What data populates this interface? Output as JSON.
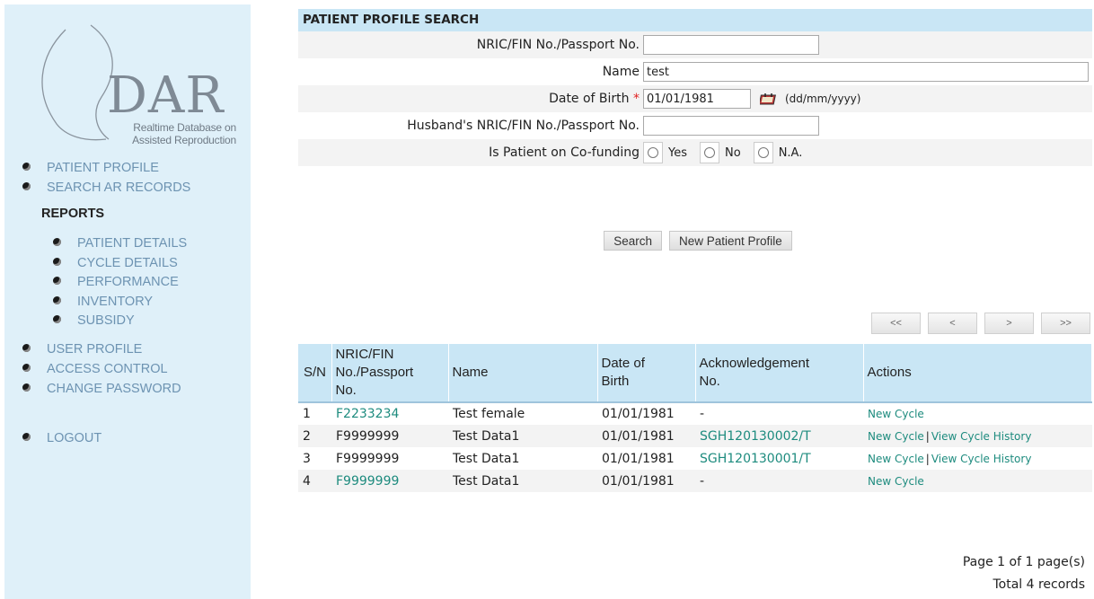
{
  "logo": {
    "wordmark": "DAR",
    "tagline_line1": "Realtime Database on",
    "tagline_line2": "Assisted Reproduction"
  },
  "sidebar": {
    "items_top": [
      "PATIENT PROFILE",
      "SEARCH AR RECORDS"
    ],
    "reports_header": "REPORTS",
    "reports_items": [
      "PATIENT DETAILS",
      "CYCLE DETAILS",
      "PERFORMANCE",
      "INVENTORY",
      "SUBSIDY"
    ],
    "items_bottom": [
      "USER PROFILE",
      "ACCESS CONTROL",
      "CHANGE PASSWORD"
    ],
    "logout": "LOGOUT"
  },
  "search_panel": {
    "title": "PATIENT PROFILE SEARCH",
    "nric_label": "NRIC/FIN No./Passport No.",
    "nric_value": "",
    "name_label": "Name",
    "name_value": "test",
    "dob_label": "Date of Birth",
    "dob_required_marker": "*",
    "dob_value": "01/01/1981",
    "dob_hint": "(dd/mm/yyyy)",
    "husband_label": "Husband's NRIC/FIN No./Passport No.",
    "husband_value": "",
    "cofunding_label": "Is Patient on Co-funding",
    "cofunding_options": [
      "Yes",
      "No",
      "N.A."
    ],
    "search_button": "Search",
    "new_profile_button": "New Patient Profile"
  },
  "pager": {
    "first": "<<",
    "prev": "<",
    "next": ">",
    "last": ">>"
  },
  "results": {
    "headers": {
      "sn": "S/N",
      "nric_l1": "NRIC/FIN",
      "nric_l2": "No./Passport",
      "nric_l3": "No.",
      "name": "Name",
      "dob_l1": "Date of",
      "dob_l2": "Birth",
      "ack_l1": "Acknowledgement",
      "ack_l2": "No.",
      "actions": "Actions"
    },
    "rows": [
      {
        "sn": "1",
        "nric": "F2233234",
        "name": "Test female",
        "dob": "01/01/1981",
        "ack": "-",
        "action1": "New Cycle",
        "action_sep": "",
        "action2": ""
      },
      {
        "sn": "2",
        "nric": "F9999999",
        "name": "Test Data1",
        "dob": "01/01/1981",
        "ack": "SGH120130002/T",
        "action1": "New Cycle",
        "action_sep": "|",
        "action2": "View Cycle History"
      },
      {
        "sn": "3",
        "nric": "F9999999",
        "name": "Test Data1",
        "dob": "01/01/1981",
        "ack": "SGH120130001/T",
        "action1": "New Cycle",
        "action_sep": "|",
        "action2": "View Cycle History"
      },
      {
        "sn": "4",
        "nric": "F9999999",
        "name": "Test Data1",
        "dob": "01/01/1981",
        "ack": "-",
        "action1": "New Cycle",
        "action_sep": "",
        "action2": ""
      }
    ],
    "page_info": "Page 1 of 1 page(s)",
    "total_info": "Total 4 records"
  },
  "colors": {
    "sidebar_bg": "#dff0f9",
    "header_bg": "#c9e6f5",
    "nav_text": "#6d93b2",
    "link": "#1d8b7e",
    "required": "#e02020"
  },
  "icons": [
    "bullet-icon",
    "calendar-icon",
    "logo-graphic"
  ]
}
